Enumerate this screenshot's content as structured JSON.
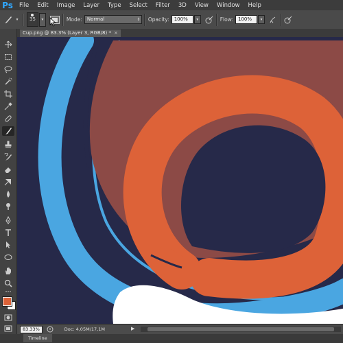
{
  "app": {
    "logo": "Ps"
  },
  "menu": [
    "File",
    "Edit",
    "Image",
    "Layer",
    "Type",
    "Select",
    "Filter",
    "3D",
    "View",
    "Window",
    "Help"
  ],
  "options": {
    "brush_size": "35",
    "mode_label": "Mode:",
    "mode_value": "Normal",
    "opacity_label": "Opacity:",
    "opacity_value": "100%",
    "flow_label": "Flow:",
    "flow_value": "100%"
  },
  "document": {
    "tab_title": "Cup.png @ 83.3% (Layer 3, RGB/8) *",
    "close": "×"
  },
  "status": {
    "zoom": "83.33%",
    "doc_info": "Doc: 4,05M/17,1M"
  },
  "bottom_panel": {
    "timeline": "Timeline"
  },
  "colors": {
    "foreground": "#dd6238",
    "background": "#ffffff",
    "canvas_bg": "#262949",
    "ring_blue": "#4aa6e1",
    "brown": "#8c4a46",
    "orange": "#dd6238"
  },
  "toolbar_icons": [
    "move-icon",
    "marquee-icon",
    "lasso-icon",
    "quick-select-icon",
    "crop-icon",
    "eyedropper-icon",
    "healing-brush-icon",
    "brush-icon",
    "clone-stamp-icon",
    "history-brush-icon",
    "eraser-icon",
    "gradient-icon",
    "blur-icon",
    "dodge-icon",
    "pen-icon",
    "type-icon",
    "path-select-icon",
    "shape-icon",
    "hand-icon",
    "zoom-icon"
  ]
}
